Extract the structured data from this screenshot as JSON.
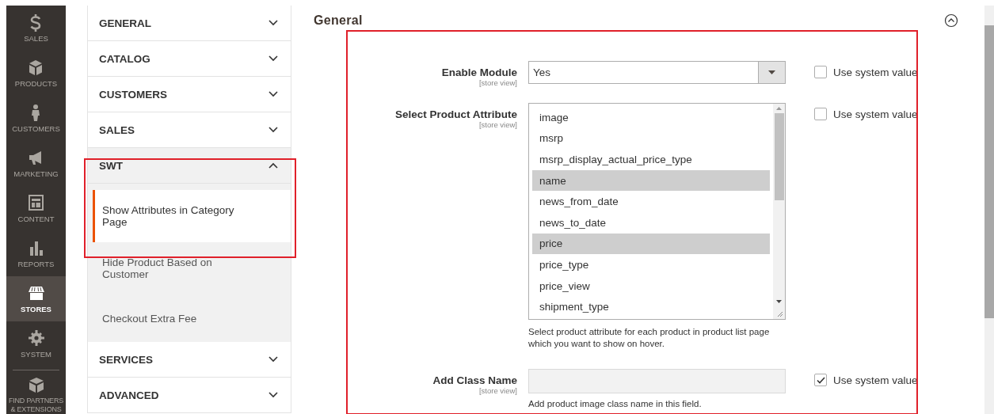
{
  "admin_menu": [
    {
      "label": "SALES",
      "selected": false
    },
    {
      "label": "PRODUCTS",
      "selected": false
    },
    {
      "label": "CUSTOMERS",
      "selected": false
    },
    {
      "label": "MARKETING",
      "selected": false
    },
    {
      "label": "CONTENT",
      "selected": false
    },
    {
      "label": "REPORTS",
      "selected": false
    },
    {
      "label": "STORES",
      "selected": true
    },
    {
      "label": "SYSTEM",
      "selected": false
    },
    {
      "label": "FIND PARTNERS & EXTENSIONS",
      "selected": false
    }
  ],
  "config_sidebar": [
    {
      "title": "GENERAL",
      "expanded": false
    },
    {
      "title": "CATALOG",
      "expanded": false
    },
    {
      "title": "CUSTOMERS",
      "expanded": false
    },
    {
      "title": "SALES",
      "expanded": false
    },
    {
      "title": "SWT",
      "expanded": true,
      "children": [
        {
          "label": "Show Attributes in Category Page",
          "selected": true
        },
        {
          "label": "Hide Product Based on Customer",
          "selected": false
        },
        {
          "label": "Checkout Extra Fee",
          "selected": false
        }
      ]
    },
    {
      "title": "SERVICES",
      "expanded": false
    },
    {
      "title": "ADVANCED",
      "expanded": false
    }
  ],
  "section": {
    "title": "General",
    "expanded": true,
    "fields": [
      {
        "kind": "select",
        "label": "Enable Module",
        "scope": "[store view]",
        "value": "Yes",
        "system_label": "Use system value",
        "use_system_value": false
      },
      {
        "kind": "multiselect",
        "label": "Select Product Attribute",
        "scope": "[store view]",
        "options": [
          {
            "label": "image",
            "selected": false
          },
          {
            "label": "msrp",
            "selected": false
          },
          {
            "label": "msrp_display_actual_price_type",
            "selected": false
          },
          {
            "label": "name",
            "selected": true
          },
          {
            "label": "news_from_date",
            "selected": false
          },
          {
            "label": "news_to_date",
            "selected": false
          },
          {
            "label": "price",
            "selected": true
          },
          {
            "label": "price_type",
            "selected": false
          },
          {
            "label": "price_view",
            "selected": false
          },
          {
            "label": "shipment_type",
            "selected": false
          }
        ],
        "note": "Select product attribute for each product in product list page which you want to show on hover.",
        "system_label": "Use system value",
        "use_system_value": false
      },
      {
        "kind": "text",
        "label": "Add Class Name",
        "scope": "[store view]",
        "note": "Add product image class name in this field.",
        "system_label": "Use system value",
        "use_system_value": true
      }
    ]
  }
}
